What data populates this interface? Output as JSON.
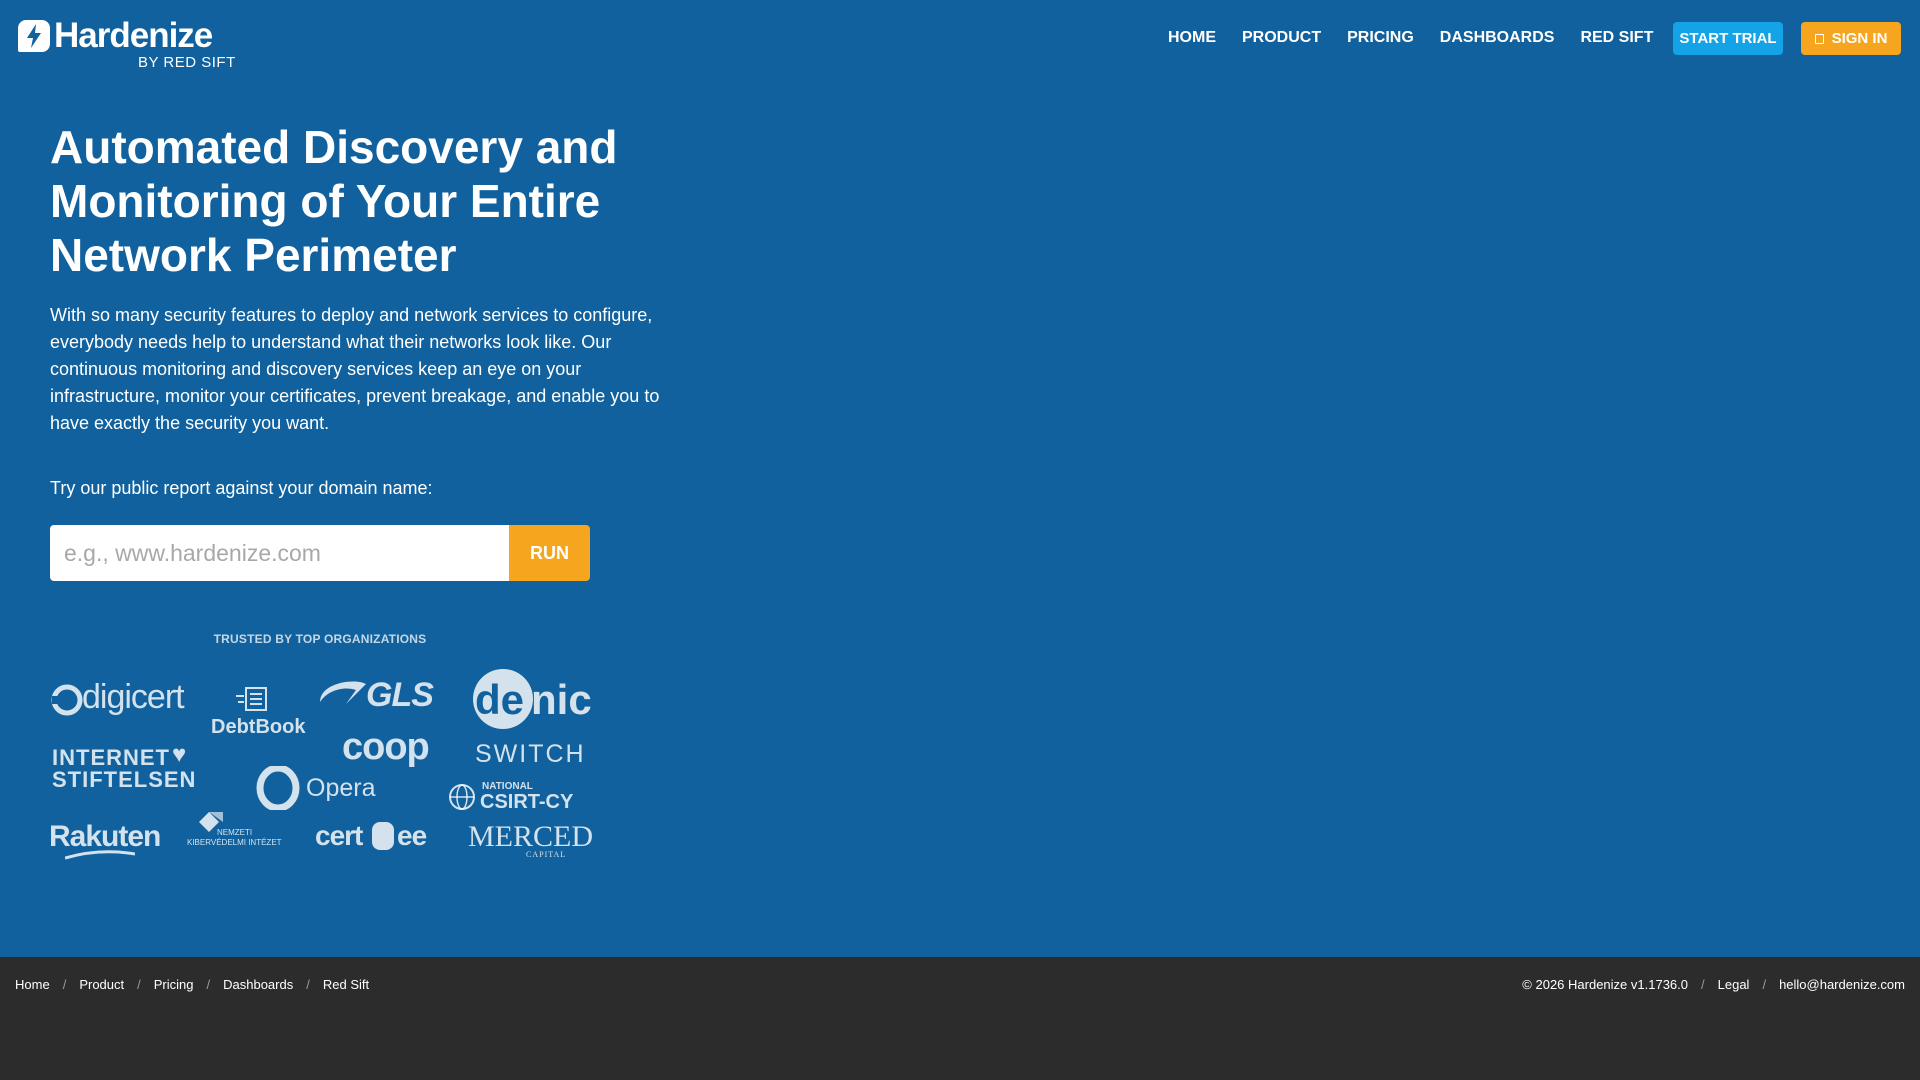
{
  "brand": {
    "name": "Hardenize",
    "sub": "BY RED SIFT"
  },
  "nav": {
    "items": [
      {
        "label": "HOME"
      },
      {
        "label": "PRODUCT"
      },
      {
        "label": "PRICING"
      },
      {
        "label": "DASHBOARDS"
      },
      {
        "label": "RED SIFT"
      }
    ],
    "start_trial": "START TRIAL",
    "sign_in": "SIGN IN"
  },
  "hero": {
    "title": "Automated Discovery and Monitoring of Your Entire Network Perimeter",
    "description": "With so many security features to deploy and network services to configure, everybody needs help to understand what their networks look like. Our continuous monitoring and discovery services keep an eye on your infrastructure, monitor your certificates, prevent breakage, and enable you to have exactly the security you want.",
    "try_label": "Try our public report against your domain name:",
    "search_placeholder": "e.g., www.hardenize.com",
    "search_value": "",
    "run_label": "RUN"
  },
  "trusted": {
    "heading": "TRUSTED BY TOP ORGANIZATIONS",
    "logos": {
      "digicert": "digicert",
      "debtbook": "DebtBook",
      "gls": "GLS",
      "denic_de": "de",
      "denic_nic": "nic",
      "internet_l1": "INTERNET",
      "internet_l2": "STIFTELSEN",
      "coop": "coop",
      "switch": "SWITCH",
      "opera": "Opera",
      "csirt_small": "NATIONAL",
      "csirt_big": "CSIRT-CY",
      "rakuten": "Rakuten",
      "nki_l1": "NEMZETI",
      "nki_l2": "KIBERVÉDELMI INTÉZET",
      "cert_a": "cert",
      "cert_b": "ee",
      "merced": "MERCED",
      "merced_sub": "CAPITAL"
    }
  },
  "footer": {
    "crumbs": [
      {
        "label": "Home"
      },
      {
        "label": "Product"
      },
      {
        "label": "Pricing"
      },
      {
        "label": "Dashboards"
      },
      {
        "label": "Red Sift"
      }
    ],
    "copyright": "© 2026 Hardenize v1.1736.0",
    "legal": "Legal",
    "email": "hello@hardenize.com"
  },
  "colors": {
    "background": "#10619d",
    "footer": "#2c2c2c",
    "accent_orange": "#f6a61e",
    "accent_blue": "#14a3e6"
  }
}
